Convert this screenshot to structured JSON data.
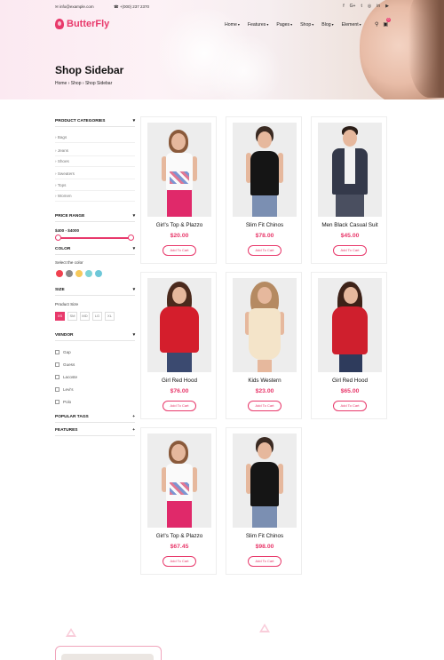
{
  "topbar": {
    "email": "info@example.com",
    "phone": "+(000) 237 2370",
    "socials": [
      "facebook-icon",
      "google-plus-icon",
      "twitter-icon",
      "instagram-icon",
      "linkedin-icon",
      "youtube-icon"
    ]
  },
  "brand": {
    "name": "ButterFly",
    "color": "#e8396b"
  },
  "nav": {
    "items": [
      {
        "label": "Home"
      },
      {
        "label": "Features"
      },
      {
        "label": "Pages"
      },
      {
        "label": "Shop"
      },
      {
        "label": "Blog"
      },
      {
        "label": "Element"
      }
    ],
    "cart_count": "0"
  },
  "page": {
    "title": "Shop Sidebar",
    "breadcrumb": [
      "Home",
      "Shop",
      "Shop Sidebar"
    ]
  },
  "sidebar": {
    "categories": {
      "title": "PRODUCT CATEGORIES",
      "items": [
        "Bags",
        "Jeans",
        "Shoes",
        "Sweaters",
        "Tops",
        "Women"
      ]
    },
    "price": {
      "title": "PRICE RANGE",
      "value": "$400 - $4000"
    },
    "color": {
      "title": "COLOR",
      "label": "Select the color",
      "swatches": [
        "#f0414f",
        "#8a8a8a",
        "#f6c95b",
        "#7ed3d6",
        "#6dc7d8"
      ]
    },
    "size": {
      "title": "SIZE",
      "label": "Product Size",
      "options": [
        "XS",
        "SM",
        "MD",
        "LG",
        "XL"
      ],
      "selected": "XS"
    },
    "vendor": {
      "title": "VENDOR",
      "items": [
        "Gap",
        "Guess",
        "Lacoste",
        "Levi's",
        "Polo"
      ]
    },
    "popular_tags": {
      "title": "POPULAR TAGS"
    },
    "features": {
      "title": "FEATURES"
    }
  },
  "products": [
    {
      "name": "Girl's Top & Plazzo",
      "price": "$20.00",
      "button": "Add To Cart"
    },
    {
      "name": "Slim Fit Chinos",
      "price": "$78.00",
      "button": "Add To Cart"
    },
    {
      "name": "Men Black Casual Suit",
      "price": "$45.00",
      "button": "Add To Cart"
    },
    {
      "name": "Girl Red Hood",
      "price": "$76.00",
      "button": "Add To Cart"
    },
    {
      "name": "Kids Western",
      "price": "$23.00",
      "button": "Add To Cart"
    },
    {
      "name": "Girl Red Hood",
      "price": "$65.00",
      "button": "Add To Cart"
    },
    {
      "name": "Girl's Top & Plazzo",
      "price": "$67.45",
      "button": "Add To Cart"
    },
    {
      "name": "Slim Fit Chinos",
      "price": "$98.00",
      "button": "Add To Cart"
    }
  ]
}
